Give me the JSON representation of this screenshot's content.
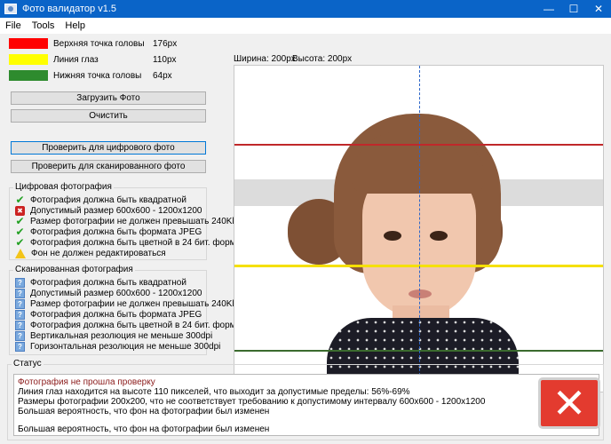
{
  "window": {
    "title": "Фото валидатор v1.5",
    "minimize": "—",
    "maximize": "☐",
    "close": "✕"
  },
  "menu": [
    "File",
    "Tools",
    "Help"
  ],
  "legend": [
    {
      "label": "Верхняя точка головы",
      "value": "176px",
      "color": "#ff0000"
    },
    {
      "label": "Линия глаз",
      "value": "110px",
      "color": "#ffff00"
    },
    {
      "label": "Нижняя точка головы",
      "value": "64px",
      "color": "#2e8b2e"
    }
  ],
  "buttons": {
    "load": "Загрузить Фото",
    "clear": "Очистить",
    "check_digital": "Проверить для цифрового фото",
    "check_scanned": "Проверить для сканированного фото"
  },
  "digital": {
    "title": "Цифровая фотография",
    "items": [
      {
        "status": "ok",
        "text": "Фотография должна быть квадратной"
      },
      {
        "status": "error",
        "text": "Допустимый размер 600x600 - 1200x1200"
      },
      {
        "status": "ok",
        "text": "Размер фотографии не должен превышать 240Kb"
      },
      {
        "status": "ok",
        "text": "Фотография должна быть формата JPEG"
      },
      {
        "status": "ok",
        "text": "Фотография должна быть цветной в 24 бит. формате"
      },
      {
        "status": "warning",
        "text": "Фон не должен редактироваться"
      }
    ]
  },
  "scanned": {
    "title": "Сканированная фотография",
    "items": [
      {
        "status": "unknown",
        "text": "Фотография должна быть квадратной"
      },
      {
        "status": "unknown",
        "text": "Допустимый размер 600x600 - 1200x1200"
      },
      {
        "status": "unknown",
        "text": "Размер фотографии не должен превышать 240Kb"
      },
      {
        "status": "unknown",
        "text": "Фотография должна быть формата JPEG"
      },
      {
        "status": "unknown",
        "text": "Фотография должна быть цветной в 24 бит. формате"
      },
      {
        "status": "unknown",
        "text": "Вертикальная резолюция не меньше 300dpi"
      },
      {
        "status": "unknown",
        "text": "Горизонтальная резолюция не меньше 300dpi"
      }
    ]
  },
  "photo": {
    "width_label": "Ширина: 200px",
    "height_label": "Высота: 200px",
    "guide_colors": {
      "top": "#c0282a",
      "eyes": "#f5e000",
      "bottom": "#3b6b2e",
      "center": "#2d66c8"
    }
  },
  "status": {
    "title": "Статус",
    "lines": [
      {
        "text": "Фотография не прошла проверку",
        "color": "#8b1a1a"
      },
      {
        "text": "Линия глаз находится на высоте 110 пикселей, что выходит за допустимые пределы: 56%-69%",
        "color": "#000000"
      },
      {
        "text": "Размеры фотографии 200x200, что не соответствует требованию к допустимому интервалу 600x600 - 1200x1200",
        "color": "#000000"
      },
      {
        "text": "Большая вероятность, что фон на фотографии был изменен",
        "color": "#000000"
      },
      {
        "text": "Большая вероятность, что фон на фотографии был изменен",
        "color": "#000000"
      }
    ],
    "result_icon": "fail-x-icon",
    "result_color": "#e33b2f"
  }
}
